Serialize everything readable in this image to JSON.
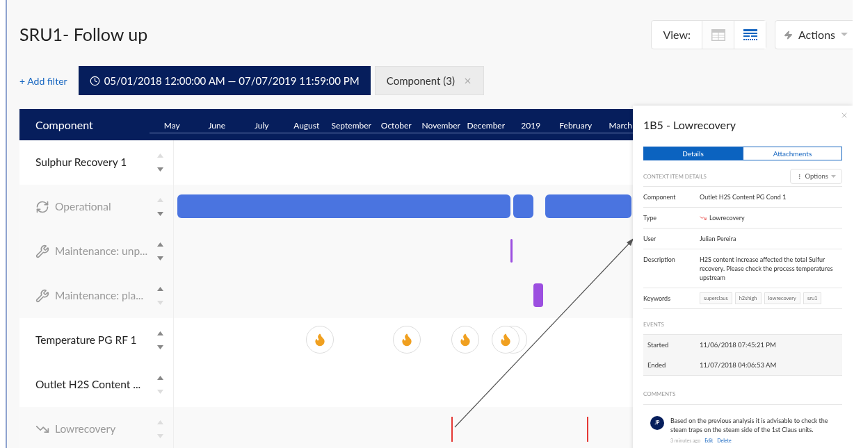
{
  "title": "SRU1- Follow up",
  "view": {
    "label": "View:",
    "options": [
      {
        "kind": "table",
        "selected": false
      },
      {
        "kind": "timeline",
        "selected": true
      }
    ]
  },
  "actions": {
    "label": "Actions"
  },
  "filters": {
    "add": "+ Add filter",
    "date_range": "05/01/2018 12:00:00 AM — 07/07/2019 11:59:00 PM",
    "chip": "Component (3)"
  },
  "timeline": {
    "column": "Component",
    "months": [
      "May",
      "June",
      "July",
      "August",
      "September",
      "October",
      "November",
      "December",
      "2019",
      "February",
      "March"
    ],
    "rows": [
      {
        "label": "Sulphur Recovery 1",
        "kind": "group",
        "can_move_up": false,
        "can_move_down": true
      },
      {
        "label": "Operational",
        "kind": "state",
        "can_move_up": false,
        "can_move_down": true
      },
      {
        "label": "Maintenance: unp...",
        "kind": "maintenance",
        "can_move_up": true,
        "can_move_down": true
      },
      {
        "label": "Maintenance: pla...",
        "kind": "maintenance",
        "can_move_up": true,
        "can_move_down": false
      },
      {
        "label": "Temperature PG RF 1",
        "kind": "group",
        "can_move_up": true,
        "can_move_down": true
      },
      {
        "label": "Outlet H2S Content ...",
        "kind": "group",
        "can_move_up": true,
        "can_move_down": false
      },
      {
        "label": "Lowrecovery",
        "kind": "deviation",
        "can_move_up": false,
        "can_move_down": false
      }
    ]
  },
  "panel": {
    "title": "1B5 - Lowrecovery",
    "tabs": [
      {
        "label": "Details",
        "selected": true
      },
      {
        "label": "Attachments",
        "selected": false
      }
    ],
    "section": "CONTEXT ITEM DETAILS",
    "options": "Options",
    "details": [
      {
        "key": "Component",
        "value": "Outlet H2S Content PG Cond 1"
      },
      {
        "key": "Type",
        "value": "Lowrecovery",
        "kind": "type"
      },
      {
        "key": "User",
        "value": "Julian Pereira"
      },
      {
        "key": "Description",
        "value": "H2S content increase affected the total Sulfur recovery. Please check the process temperatures upstream"
      }
    ],
    "keywords_label": "Keywords",
    "keywords": [
      "superclaus",
      "h2shigh",
      "lowrecovery",
      "sru1"
    ],
    "events_label": "EVENTS",
    "events": [
      {
        "key": "Started",
        "value": "11/06/2018 07:45:21 PM"
      },
      {
        "key": "Ended",
        "value": "11/07/2018 04:06:53 AM"
      }
    ],
    "comments_label": "COMMENTS",
    "comments": [
      {
        "initials": "JP",
        "text": "Based on the previous analysis it is advisable to check the steam traps on the steam side of the 1st Claus units.",
        "time": "3 minutes ago",
        "edit": "Edit",
        "delete": "Delete"
      }
    ]
  }
}
